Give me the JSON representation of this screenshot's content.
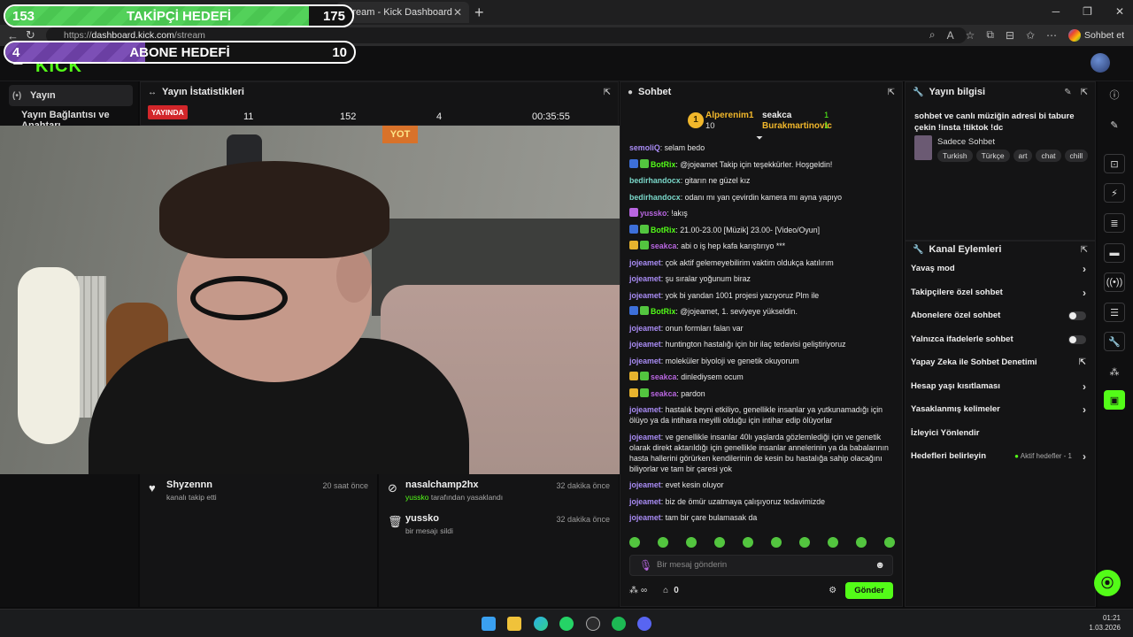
{
  "browser": {
    "tab_title": "Stream - Kick Dashboard",
    "url_prefix": "https://",
    "url_host": "dashboard.kick.com",
    "url_path": "/stream",
    "profile_label": "Sohbet et"
  },
  "overlays": {
    "follower_goal": {
      "current": "153",
      "label": "TAKİPÇİ HEDEFİ",
      "target": "175",
      "progress": 0.874
    },
    "sub_goal": {
      "current": "4",
      "label": "ABONE HEDEFİ",
      "target": "10",
      "progress": 0.4
    }
  },
  "app": {
    "logo": "KICK"
  },
  "leftnav": {
    "items": [
      {
        "label": "Yayın",
        "icon": "broadcast-icon"
      },
      {
        "label": "Yayın Bağlantısı ve Anahtarı"
      }
    ]
  },
  "stats": {
    "title": "Yayın İstatistikleri",
    "live_badge": "YAYINDA",
    "values": [
      "11",
      "152",
      "4",
      "00:35:55"
    ]
  },
  "video": {
    "sign_text": "YOT"
  },
  "feed_left": [
    {
      "name": "Shyzennn",
      "sub": "kanalı takip etti",
      "time": "20 saat önce",
      "icon": "heart-icon"
    }
  ],
  "feed_right": [
    {
      "name": "nasalchamp2hx",
      "sub_user": "yussko",
      "sub": " tarafından yasaklandı",
      "time": "32 dakika önce",
      "icon": "ban-icon"
    },
    {
      "name": "yussko",
      "sub_user": "",
      "sub": "bir mesajı sildi",
      "time": "32 dakika önce",
      "icon": "trash-icon"
    }
  ],
  "chat": {
    "title": "Sohbet",
    "leaderboard": {
      "rank": "1",
      "first_name": "Alperenim1",
      "first_value": "10",
      "second_name": "seakca",
      "second_value": "1",
      "third_name": "Burakmartinovic",
      "third_value": "1"
    },
    "messages": [
      {
        "user": "semoliQ",
        "color": "#a98cf5",
        "text": "selam bedo",
        "badges": []
      },
      {
        "user": "BotRix",
        "color": "#53fc18",
        "text": "@jojeamet Takip için teşekkürler. Hoşgeldin!",
        "badges": [
          "#3d6fd9",
          "#53c53f"
        ]
      },
      {
        "user": "bedirhandocx",
        "color": "#7ad7c9",
        "text": "gitarın ne güzel kız",
        "badges": []
      },
      {
        "user": "bedirhandocx",
        "color": "#7ad7c9",
        "text": "odanı mı yan çevirdin kamera mı ayna yapıyo",
        "badges": []
      },
      {
        "user": "yussko",
        "color": "#b866e0",
        "text": "!akış",
        "badges": [
          "#b866e0"
        ]
      },
      {
        "user": "BotRix",
        "color": "#53fc18",
        "text": "21.00-23.00 [Müzik] 23.00- [Video/Oyun]",
        "badges": [
          "#3d6fd9",
          "#53c53f"
        ]
      },
      {
        "user": "seakca",
        "color": "#b866e0",
        "text": "abi o iş hep kafa karıştırıyo ***",
        "badges": [
          "#e6b22e",
          "#53c53f"
        ]
      },
      {
        "user": "jojeamet",
        "color": "#a98cf5",
        "text": "çok aktif gelemeyebilirim vaktim oldukça katılırım",
        "badges": []
      },
      {
        "user": "jojeamet",
        "color": "#a98cf5",
        "text": "şu sıralar yoğunum biraz",
        "badges": []
      },
      {
        "user": "jojeamet",
        "color": "#a98cf5",
        "text": "yok bi yandan 1001 projesi yazıyoruz Plm ile",
        "badges": []
      },
      {
        "user": "BotRix",
        "color": "#53fc18",
        "text": "@jojeamet, 1. seviyeye yükseldin.",
        "badges": [
          "#3d6fd9",
          "#53c53f"
        ]
      },
      {
        "user": "jojeamet",
        "color": "#a98cf5",
        "text": "onun formları falan var",
        "badges": []
      },
      {
        "user": "jojeamet",
        "color": "#a98cf5",
        "text": "huntington hastalığı için bir ilaç tedavisi geliştiriyoruz",
        "badges": []
      },
      {
        "user": "jojeamet",
        "color": "#a98cf5",
        "text": "moleküler biyoloji ve genetik okuyorum",
        "badges": []
      },
      {
        "user": "seakca",
        "color": "#b866e0",
        "text": "dinlediysem ocum",
        "badges": [
          "#e6b22e",
          "#53c53f"
        ]
      },
      {
        "user": "seakca",
        "color": "#b866e0",
        "text": "pardon",
        "badges": [
          "#e6b22e",
          "#53c53f"
        ]
      },
      {
        "user": "jojeamet",
        "color": "#a98cf5",
        "text": "hastalık beyni etkiliyo, genellikle insanlar ya yutkunamadığı için ölüyo ya da intihara meyilli olduğu için intihar edip ölüyorlar",
        "badges": []
      },
      {
        "user": "jojeamet",
        "color": "#a98cf5",
        "text": "ve genellikle insanlar 40lı yaşlarda gözlemlediği için ve genetik olarak direkt aktarıldığı için genellikle insanlar annelerinin ya da babalarının hasta hallerini görürken kendilerinin de kesin bu hastalığa sahip olacağını biliyorlar ve tam bir çaresi yok",
        "badges": []
      },
      {
        "user": "jojeamet",
        "color": "#a98cf5",
        "text": "evet kesin oluyor",
        "badges": []
      },
      {
        "user": "jojeamet",
        "color": "#a98cf5",
        "text": "biz de ömür uzatmaya çalışıyoruz tedavimizde",
        "badges": []
      },
      {
        "user": "jojeamet",
        "color": "#a98cf5",
        "text": "tam bir çare bulamasak da",
        "badges": []
      }
    ],
    "input_placeholder": "Bir mesaj gönderin",
    "points_label": "∞",
    "store_count": "0",
    "send_label": "Gönder"
  },
  "info": {
    "title": "Yayın bilgisi",
    "stream_title": "sohbet ve canlı müziğin adresi bi tabure çekin !insta !tiktok !dc",
    "category": "Sadece Sohbet",
    "tags": [
      "Turkish",
      "Türkçe",
      "art",
      "chat",
      "chill"
    ]
  },
  "actions": {
    "title": "Kanal Eylemleri",
    "items": [
      {
        "label": "Yavaş mod",
        "kind": "chevron"
      },
      {
        "label": "Takipçilere özel sohbet",
        "kind": "chevron"
      },
      {
        "label": "Abonelere özel sohbet",
        "kind": "toggle"
      },
      {
        "label": "Yalnızca ifadelerle sohbet",
        "kind": "toggle"
      },
      {
        "label": "Yapay Zeka ile Sohbet Denetimi",
        "kind": "external"
      },
      {
        "label": "Hesap yaşı kısıtlaması",
        "kind": "chevron"
      },
      {
        "label": "Yasaklanmış kelimeler",
        "kind": "chevron"
      },
      {
        "label": "İzleyici Yönlendir",
        "kind": "none"
      },
      {
        "label": "Hedefleri belirleyin",
        "kind": "chevron",
        "side": "Aktif hedefler - 1"
      }
    ]
  },
  "taskbar": {
    "time": "01:21",
    "date": "1.03.2026"
  }
}
